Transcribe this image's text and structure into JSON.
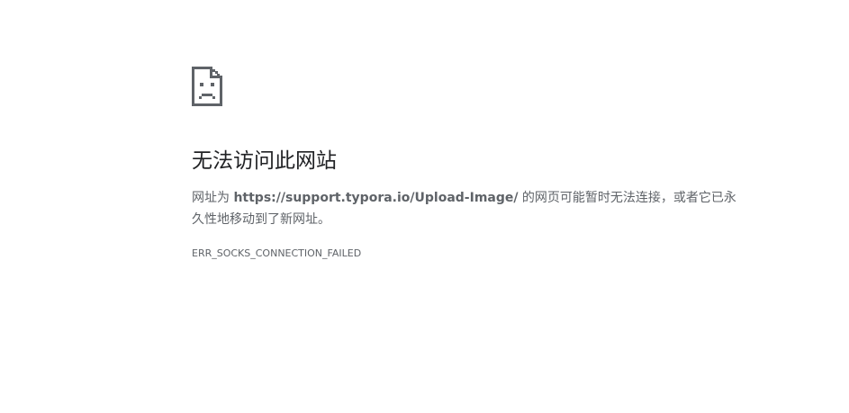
{
  "error": {
    "title": "无法访问此网站",
    "desc_prefix": "网址为 ",
    "url": "https://support.typora.io/Upload-Image/",
    "desc_suffix": " 的网页可能暂时无法连接，或者它已永久性地移动到了新网址。",
    "code": "ERR_SOCKS_CONNECTION_FAILED",
    "icon": "sad-page-icon"
  },
  "colors": {
    "title": "#202124",
    "text": "#5f6368",
    "icon": "#5f6368",
    "background": "#ffffff"
  }
}
